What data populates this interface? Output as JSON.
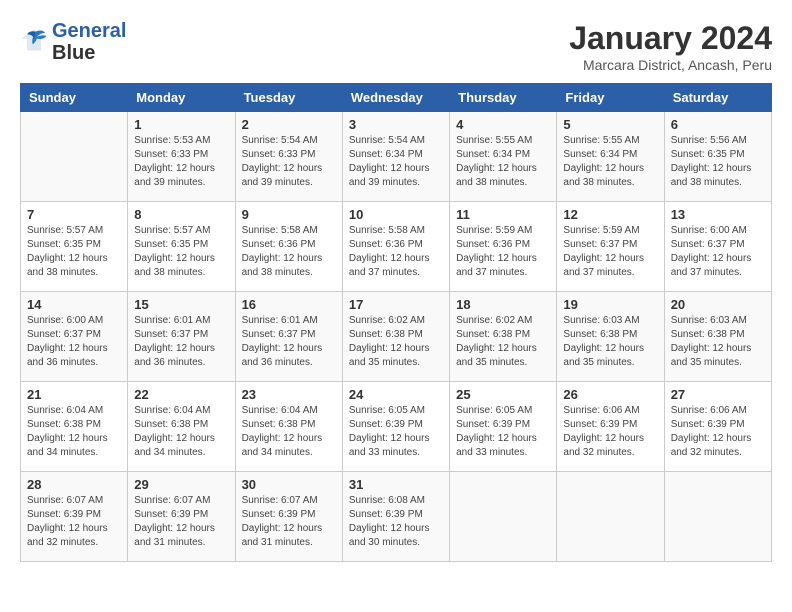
{
  "logo": {
    "line1": "General",
    "line2": "Blue"
  },
  "title": "January 2024",
  "subtitle": "Marcara District, Ancash, Peru",
  "days_of_week": [
    "Sunday",
    "Monday",
    "Tuesday",
    "Wednesday",
    "Thursday",
    "Friday",
    "Saturday"
  ],
  "weeks": [
    [
      {
        "day": "",
        "info": ""
      },
      {
        "day": "1",
        "info": "Sunrise: 5:53 AM\nSunset: 6:33 PM\nDaylight: 12 hours\nand 39 minutes."
      },
      {
        "day": "2",
        "info": "Sunrise: 5:54 AM\nSunset: 6:33 PM\nDaylight: 12 hours\nand 39 minutes."
      },
      {
        "day": "3",
        "info": "Sunrise: 5:54 AM\nSunset: 6:34 PM\nDaylight: 12 hours\nand 39 minutes."
      },
      {
        "day": "4",
        "info": "Sunrise: 5:55 AM\nSunset: 6:34 PM\nDaylight: 12 hours\nand 38 minutes."
      },
      {
        "day": "5",
        "info": "Sunrise: 5:55 AM\nSunset: 6:34 PM\nDaylight: 12 hours\nand 38 minutes."
      },
      {
        "day": "6",
        "info": "Sunrise: 5:56 AM\nSunset: 6:35 PM\nDaylight: 12 hours\nand 38 minutes."
      }
    ],
    [
      {
        "day": "7",
        "info": "Sunrise: 5:57 AM\nSunset: 6:35 PM\nDaylight: 12 hours\nand 38 minutes."
      },
      {
        "day": "8",
        "info": "Sunrise: 5:57 AM\nSunset: 6:35 PM\nDaylight: 12 hours\nand 38 minutes."
      },
      {
        "day": "9",
        "info": "Sunrise: 5:58 AM\nSunset: 6:36 PM\nDaylight: 12 hours\nand 38 minutes."
      },
      {
        "day": "10",
        "info": "Sunrise: 5:58 AM\nSunset: 6:36 PM\nDaylight: 12 hours\nand 37 minutes."
      },
      {
        "day": "11",
        "info": "Sunrise: 5:59 AM\nSunset: 6:36 PM\nDaylight: 12 hours\nand 37 minutes."
      },
      {
        "day": "12",
        "info": "Sunrise: 5:59 AM\nSunset: 6:37 PM\nDaylight: 12 hours\nand 37 minutes."
      },
      {
        "day": "13",
        "info": "Sunrise: 6:00 AM\nSunset: 6:37 PM\nDaylight: 12 hours\nand 37 minutes."
      }
    ],
    [
      {
        "day": "14",
        "info": "Sunrise: 6:00 AM\nSunset: 6:37 PM\nDaylight: 12 hours\nand 36 minutes."
      },
      {
        "day": "15",
        "info": "Sunrise: 6:01 AM\nSunset: 6:37 PM\nDaylight: 12 hours\nand 36 minutes."
      },
      {
        "day": "16",
        "info": "Sunrise: 6:01 AM\nSunset: 6:37 PM\nDaylight: 12 hours\nand 36 minutes."
      },
      {
        "day": "17",
        "info": "Sunrise: 6:02 AM\nSunset: 6:38 PM\nDaylight: 12 hours\nand 35 minutes."
      },
      {
        "day": "18",
        "info": "Sunrise: 6:02 AM\nSunset: 6:38 PM\nDaylight: 12 hours\nand 35 minutes."
      },
      {
        "day": "19",
        "info": "Sunrise: 6:03 AM\nSunset: 6:38 PM\nDaylight: 12 hours\nand 35 minutes."
      },
      {
        "day": "20",
        "info": "Sunrise: 6:03 AM\nSunset: 6:38 PM\nDaylight: 12 hours\nand 35 minutes."
      }
    ],
    [
      {
        "day": "21",
        "info": "Sunrise: 6:04 AM\nSunset: 6:38 PM\nDaylight: 12 hours\nand 34 minutes."
      },
      {
        "day": "22",
        "info": "Sunrise: 6:04 AM\nSunset: 6:38 PM\nDaylight: 12 hours\nand 34 minutes."
      },
      {
        "day": "23",
        "info": "Sunrise: 6:04 AM\nSunset: 6:38 PM\nDaylight: 12 hours\nand 34 minutes."
      },
      {
        "day": "24",
        "info": "Sunrise: 6:05 AM\nSunset: 6:39 PM\nDaylight: 12 hours\nand 33 minutes."
      },
      {
        "day": "25",
        "info": "Sunrise: 6:05 AM\nSunset: 6:39 PM\nDaylight: 12 hours\nand 33 minutes."
      },
      {
        "day": "26",
        "info": "Sunrise: 6:06 AM\nSunset: 6:39 PM\nDaylight: 12 hours\nand 32 minutes."
      },
      {
        "day": "27",
        "info": "Sunrise: 6:06 AM\nSunset: 6:39 PM\nDaylight: 12 hours\nand 32 minutes."
      }
    ],
    [
      {
        "day": "28",
        "info": "Sunrise: 6:07 AM\nSunset: 6:39 PM\nDaylight: 12 hours\nand 32 minutes."
      },
      {
        "day": "29",
        "info": "Sunrise: 6:07 AM\nSunset: 6:39 PM\nDaylight: 12 hours\nand 31 minutes."
      },
      {
        "day": "30",
        "info": "Sunrise: 6:07 AM\nSunset: 6:39 PM\nDaylight: 12 hours\nand 31 minutes."
      },
      {
        "day": "31",
        "info": "Sunrise: 6:08 AM\nSunset: 6:39 PM\nDaylight: 12 hours\nand 30 minutes."
      },
      {
        "day": "",
        "info": ""
      },
      {
        "day": "",
        "info": ""
      },
      {
        "day": "",
        "info": ""
      }
    ]
  ]
}
